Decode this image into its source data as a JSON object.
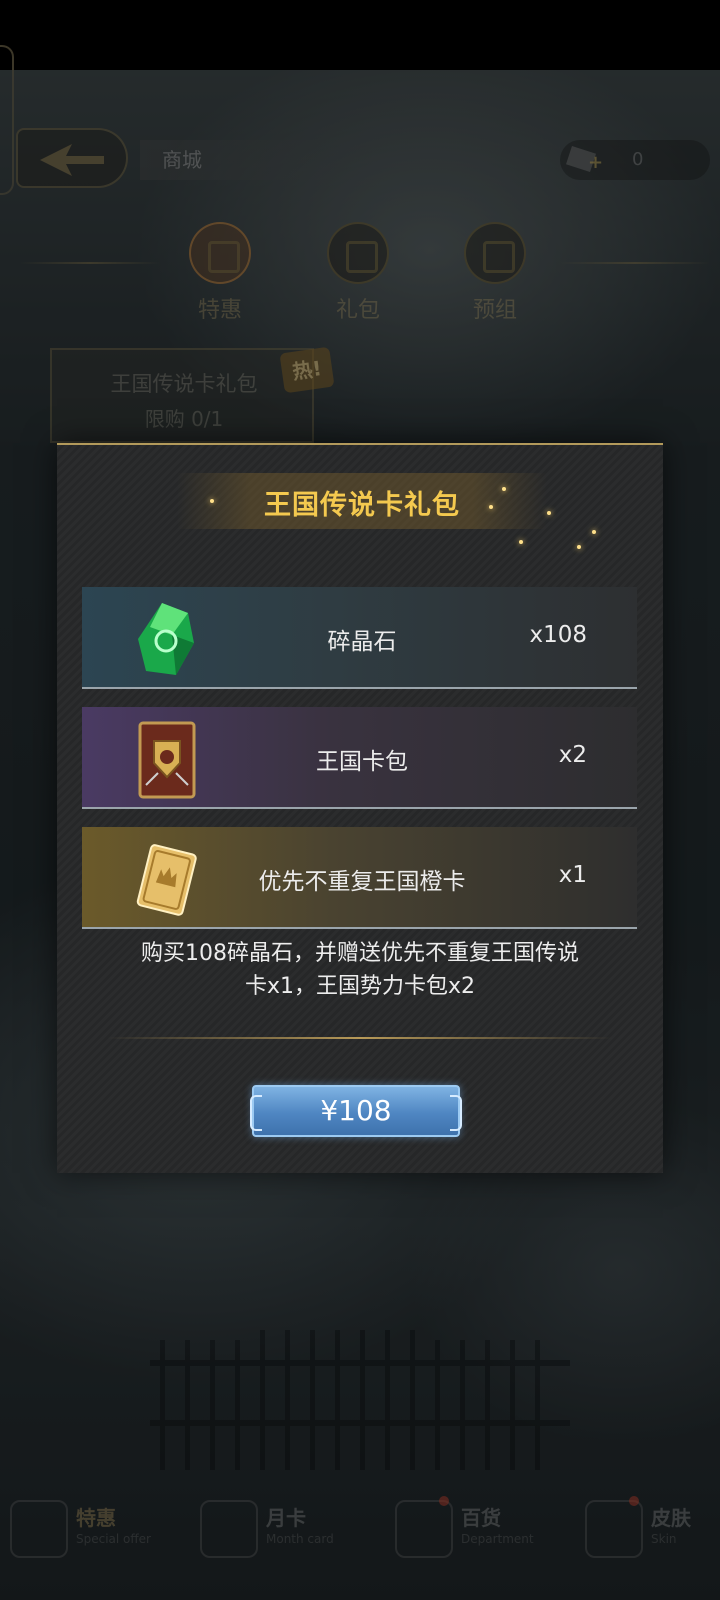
{
  "header": {
    "title": "商城",
    "currency_amount": "0"
  },
  "categories": [
    {
      "label": "特惠",
      "icon": "piggy-icon"
    },
    {
      "label": "礼包",
      "icon": "gift-icon"
    },
    {
      "label": "预组",
      "icon": "deck-icon"
    }
  ],
  "gift_card": {
    "name": "王国传说卡礼包",
    "limit": "限购 0/1",
    "badge": "热!"
  },
  "modal": {
    "title": "王国传说卡礼包",
    "items": [
      {
        "name": "碎晶石",
        "qty": "x108",
        "icon": "green-crystal-icon"
      },
      {
        "name": "王国卡包",
        "qty": "x2",
        "icon": "card-pack-icon"
      },
      {
        "name": "优先不重复王国橙卡",
        "qty": "x1",
        "icon": "golden-card-icon"
      }
    ],
    "description_line1": "购买108碎晶石，并赠送优先不重复王国传说",
    "description_line2": "卡x1，王国势力卡包x2",
    "price": "¥108"
  },
  "bottom_nav": [
    {
      "cn": "特惠",
      "en": "Special offer"
    },
    {
      "cn": "月卡",
      "en": "Month card"
    },
    {
      "cn": "百货",
      "en": "Department"
    },
    {
      "cn": "皮肤",
      "en": "Skin"
    }
  ],
  "colors": {
    "title_gold": "#f4c94f",
    "button_blue": "#4f86c2",
    "modal_border": "#b39a5b"
  }
}
